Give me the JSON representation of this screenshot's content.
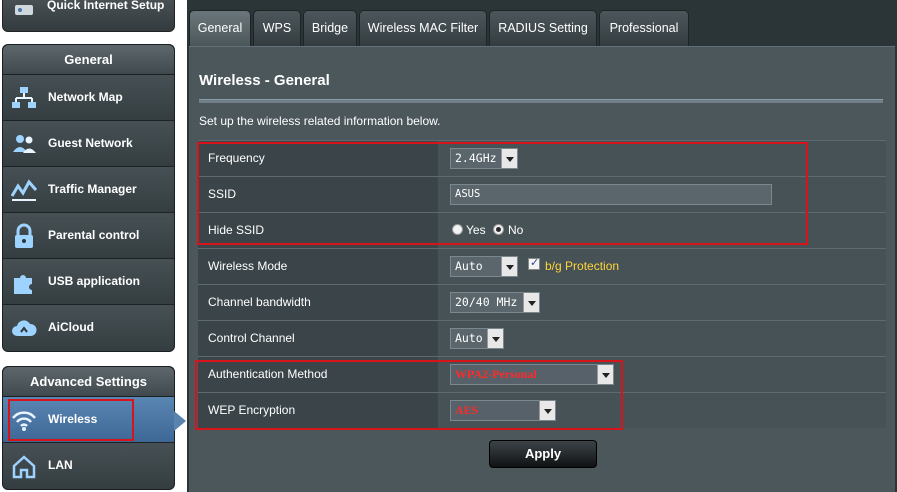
{
  "sidebar": {
    "quick_setup": "Quick Internet Setup",
    "general_header": "General",
    "general_items": [
      {
        "label": "Network Map",
        "icon": "network-map-icon"
      },
      {
        "label": "Guest Network",
        "icon": "guest-network-icon"
      },
      {
        "label": "Traffic Manager",
        "icon": "traffic-manager-icon"
      },
      {
        "label": "Parental control",
        "icon": "parental-control-icon"
      },
      {
        "label": "USB application",
        "icon": "usb-application-icon"
      },
      {
        "label": "AiCloud",
        "icon": "aicloud-icon"
      }
    ],
    "advanced_header": "Advanced Settings",
    "advanced_items": [
      {
        "label": "Wireless",
        "icon": "wireless-icon",
        "active": true
      },
      {
        "label": "LAN",
        "icon": "lan-icon"
      }
    ]
  },
  "tabs": [
    "General",
    "WPS",
    "Bridge",
    "Wireless MAC Filter",
    "RADIUS Setting",
    "Professional"
  ],
  "active_tab": "General",
  "page": {
    "title": "Wireless - General",
    "description": "Set up the wireless related information below."
  },
  "form": {
    "frequency": {
      "label": "Frequency",
      "value": "2.4GHz"
    },
    "ssid": {
      "label": "SSID",
      "value": "ASUS"
    },
    "hide_ssid": {
      "label": "Hide SSID",
      "yes": "Yes",
      "no": "No",
      "selected": "No"
    },
    "wireless_mode": {
      "label": "Wireless Mode",
      "value": "Auto",
      "protection_label": "b/g Protection",
      "protection_checked": true
    },
    "channel_bandwidth": {
      "label": "Channel bandwidth",
      "value": "20/40 MHz"
    },
    "control_channel": {
      "label": "Control Channel",
      "value": "Auto"
    },
    "auth_method": {
      "label": "Authentication Method",
      "value": "WPA2-Personal"
    },
    "wep_encryption": {
      "label": "WEP Encryption",
      "value": "AES"
    }
  },
  "apply_label": "Apply",
  "colors": {
    "highlight_red": "#d8141b",
    "accent_blue": "#4a76a3",
    "protection_yellow": "#ffd43a"
  }
}
